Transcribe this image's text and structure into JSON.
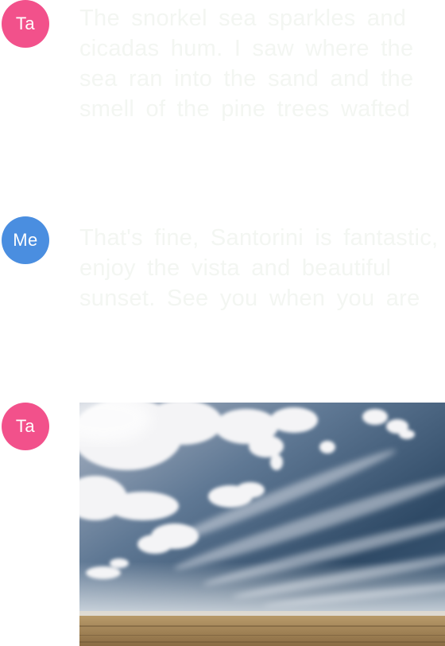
{
  "messages": [
    {
      "sender_initials": "Ta",
      "avatar_color": "#f2518b",
      "text": "The snorkel sea sparkles and cicadas hum. I saw where the sea ran into the sand and the smell of the pine trees wafted in, so I stayed for lunch."
    },
    {
      "sender_initials": "Me",
      "avatar_color": "#4a8ee0",
      "text": "That's fine, Santorini is fantastic, enjoy the vista and beautiful sunset. See you when you are back home."
    },
    {
      "sender_initials": "Ta",
      "avatar_color": "#f2518b",
      "image_alt": "photo"
    }
  ]
}
